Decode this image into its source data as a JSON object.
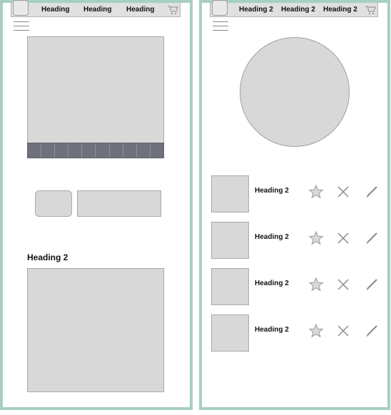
{
  "left_panel": {
    "nav": {
      "links": [
        "Heading",
        "Heading",
        "Heading"
      ],
      "logo_icon": "logo-placeholder-icon",
      "cart_icon": "cart-icon",
      "menu_icon": "hamburger-icon"
    },
    "section_heading": "Heading 2",
    "thumbnail_count": 10
  },
  "right_panel": {
    "nav": {
      "links": [
        "Heading 2",
        "Heading 2",
        "Heading 2"
      ],
      "logo_icon": "logo-placeholder-icon",
      "cart_icon": "cart-icon",
      "menu_icon": "hamburger-icon"
    },
    "list": [
      {
        "heading": "Heading 2",
        "actions": [
          "star-icon",
          "close-icon",
          "pencil-icon"
        ]
      },
      {
        "heading": "Heading 2",
        "actions": [
          "star-icon",
          "close-icon",
          "pencil-icon"
        ]
      },
      {
        "heading": "Heading 2",
        "actions": [
          "star-icon",
          "close-icon",
          "pencil-icon"
        ]
      },
      {
        "heading": "Heading 2",
        "actions": [
          "star-icon",
          "close-icon",
          "pencil-icon"
        ]
      }
    ]
  },
  "colors": {
    "frame_border": "#a7cfc4",
    "placeholder_fill": "#d8d8d8",
    "thumb_strip": "#6e717a",
    "icon_gray": "#8a8a8a"
  }
}
